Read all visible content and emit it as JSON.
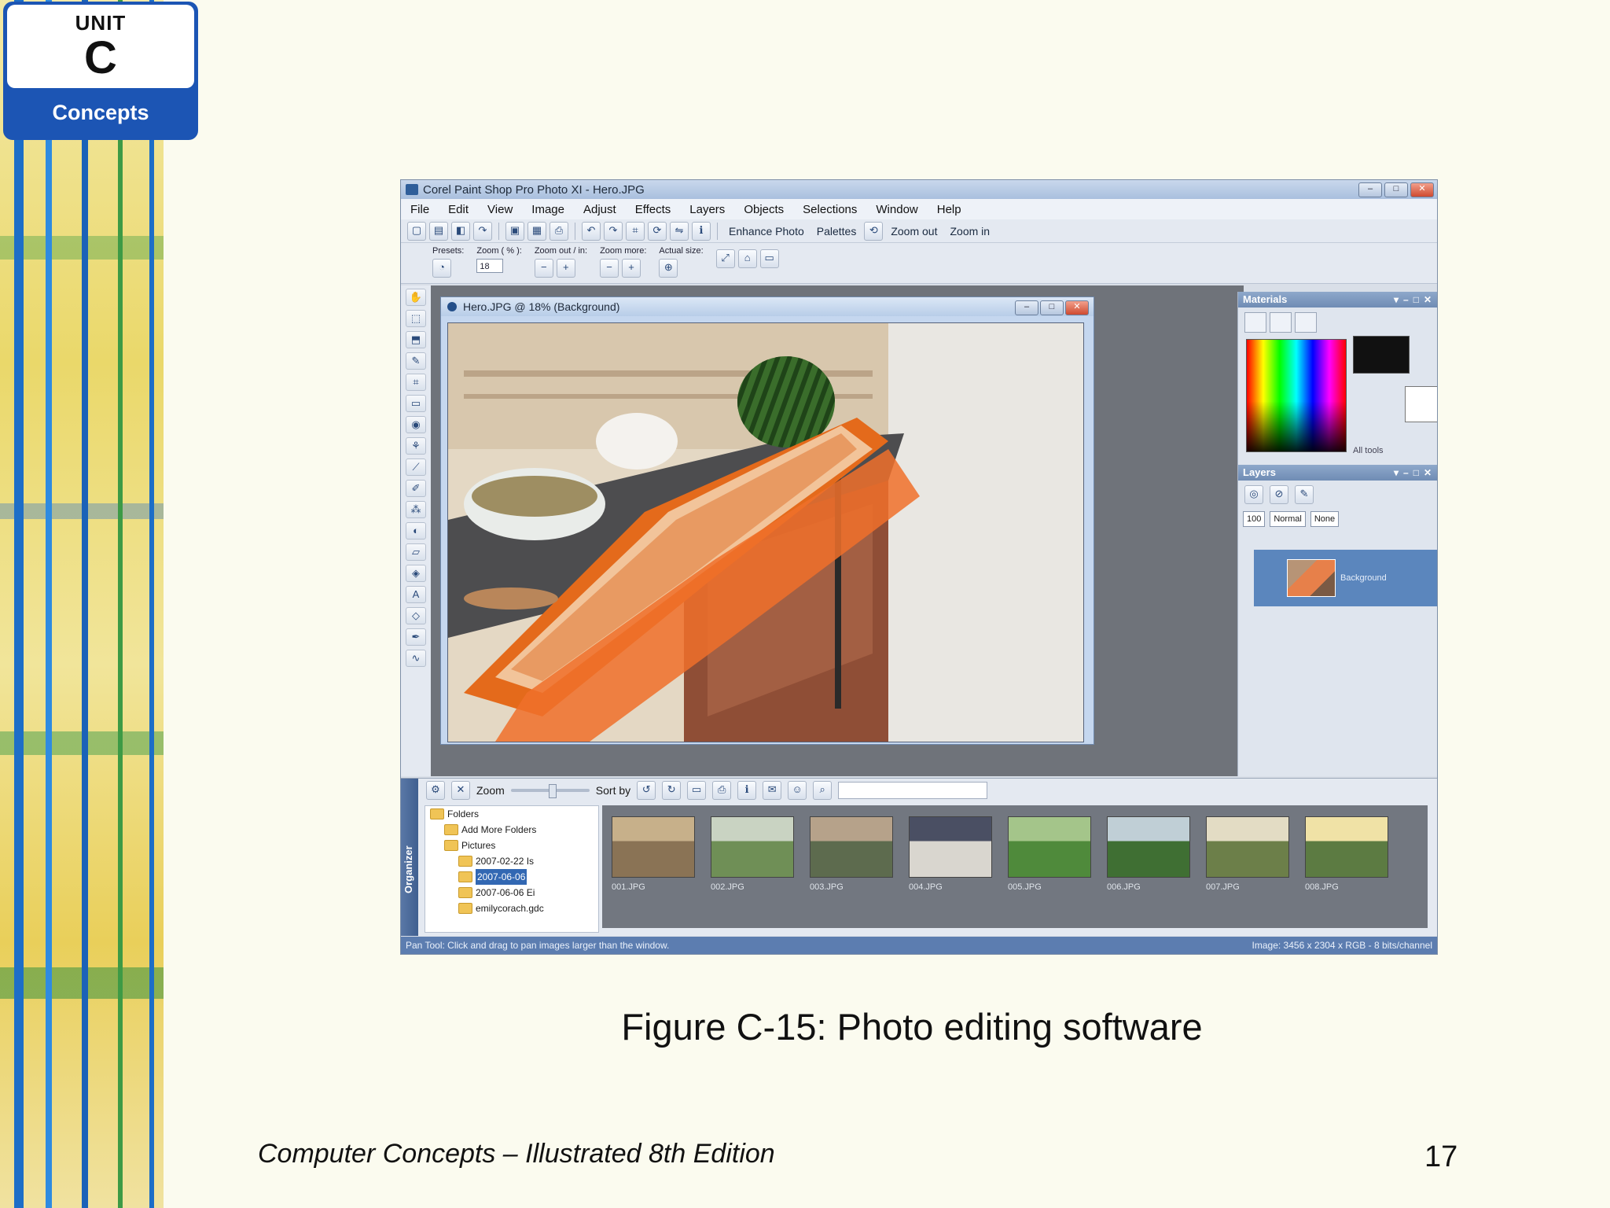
{
  "unit_badge": {
    "word": "UNIT",
    "letter": "C",
    "label": "Concepts"
  },
  "caption": "Figure C-15: Photo editing software",
  "footer": "Computer Concepts – Illustrated 8th Edition",
  "page_number": "17",
  "app": {
    "title": "Corel Paint Shop Pro Photo XI - Hero.JPG",
    "menu": [
      "File",
      "Edit",
      "View",
      "Image",
      "Adjust",
      "Effects",
      "Layers",
      "Objects",
      "Selections",
      "Window",
      "Help"
    ],
    "toolbar": {
      "enhance_photo": "Enhance Photo",
      "palettes": "Palettes",
      "zoom_out": "Zoom out",
      "zoom_in": "Zoom in"
    },
    "tool_options": {
      "presets": "Presets:",
      "zoom_pct": "Zoom ( % ):",
      "zoom_value": "18",
      "zoom_out_in": "Zoom out / in:",
      "zoom_more": "Zoom more:",
      "actual_size": "Actual size:"
    },
    "document": {
      "title": "Hero.JPG @ 18% (Background)"
    },
    "materials": {
      "title": "Materials",
      "all_tools": "All tools"
    },
    "layers": {
      "title": "Layers",
      "opacity": "100",
      "blend": "Normal",
      "none": "None",
      "layer_name": "Background"
    },
    "organizer": {
      "side_label": "Organizer",
      "zoom_label": "Zoom",
      "sort_by": "Sort by",
      "tree": [
        {
          "label": "Folders",
          "indent": 0,
          "selected": false
        },
        {
          "label": "Add More Folders",
          "indent": 1,
          "selected": false
        },
        {
          "label": "Pictures",
          "indent": 1,
          "selected": false
        },
        {
          "label": "2007-02-22 Is",
          "indent": 2,
          "selected": false
        },
        {
          "label": "2007-06-06",
          "indent": 2,
          "selected": true
        },
        {
          "label": "2007-06-06 Ei",
          "indent": 2,
          "selected": false
        },
        {
          "label": "emilycorach.gdc",
          "indent": 2,
          "selected": false
        }
      ],
      "thumbnails": [
        "001.JPG",
        "002.JPG",
        "003.JPG",
        "004.JPG",
        "005.JPG",
        "006.JPG",
        "007.JPG",
        "008.JPG"
      ]
    },
    "status": {
      "left": "Pan Tool: Click and drag to pan images larger than the window.",
      "right": "Image: 3456 x 2304 x RGB - 8 bits/channel"
    }
  }
}
